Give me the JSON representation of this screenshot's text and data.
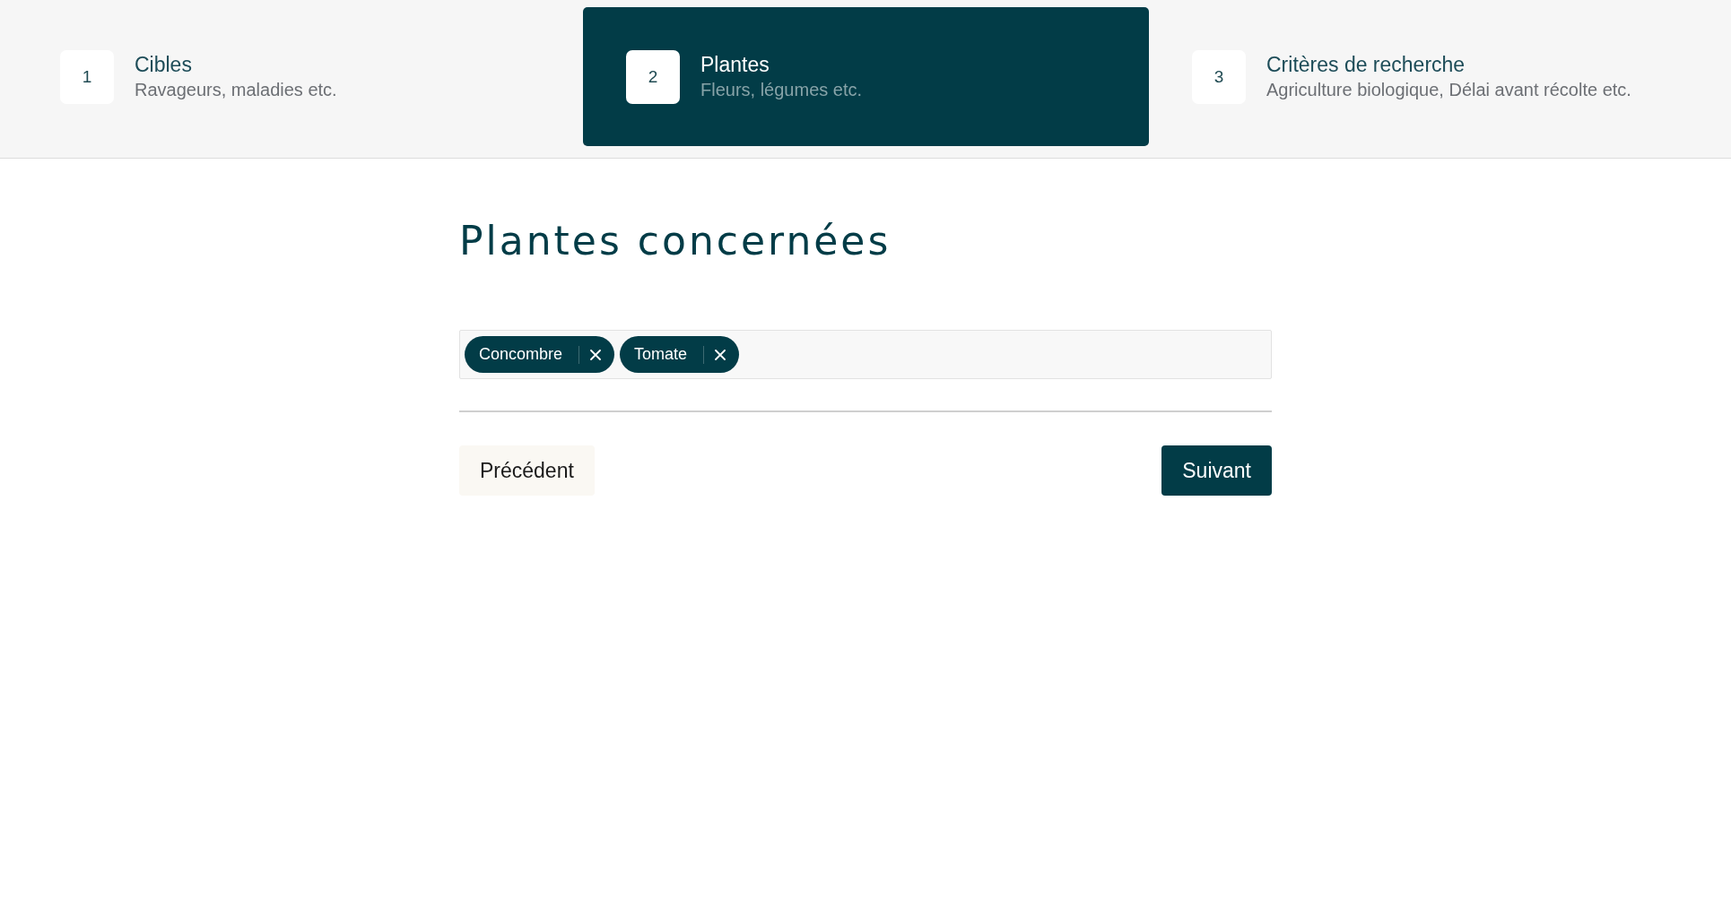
{
  "steps": [
    {
      "number": "1",
      "title": "Cibles",
      "subtitle": "Ravageurs, maladies etc.",
      "selected": false
    },
    {
      "number": "2",
      "title": "Plantes",
      "subtitle": "Fleurs, légumes etc.",
      "selected": true
    },
    {
      "number": "3",
      "title": "Critères de recherche",
      "subtitle": "Agriculture biologique, Délai avant récolte etc.",
      "selected": false
    }
  ],
  "section": {
    "title": "Plantes concernées"
  },
  "plant_field": {
    "tags": [
      {
        "label": "Concombre"
      },
      {
        "label": "Tomate"
      }
    ]
  },
  "navigation": {
    "previous": "Précédent",
    "next": "Suivant"
  }
}
